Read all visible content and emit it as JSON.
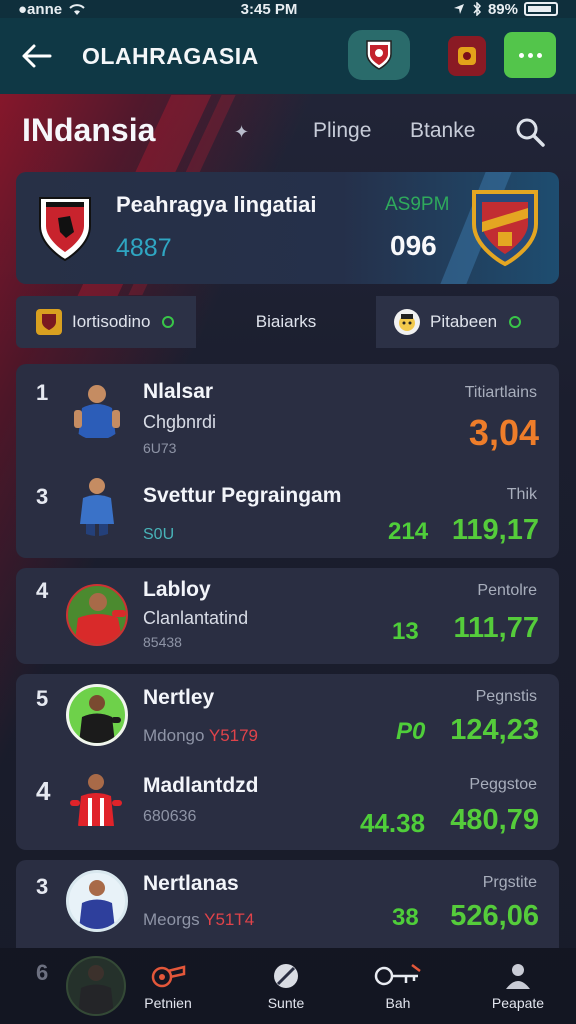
{
  "status_bar": {
    "carrier": "●anne",
    "time": "3:45 PM",
    "battery": "89%"
  },
  "app_bar": {
    "title": "OLAHRAGASIA"
  },
  "section": {
    "title": "INdansia",
    "tab_a": "Plinge",
    "tab_b": "Btanke"
  },
  "match": {
    "title": "Peahragya lingatiai",
    "score": "4887",
    "time": "AS9PM",
    "value": "096"
  },
  "filters": {
    "left": "Iortisodino",
    "middle": "Biaiarks",
    "right": "Pitabeen"
  },
  "cards": [
    {
      "rows": [
        {
          "rank": "1",
          "name": "Nlalsar",
          "team": "Chgbnrdi",
          "sub": "6U73",
          "label": "Titiartlains",
          "score": "3,04",
          "mid": ""
        },
        {
          "rank": "3",
          "name": "Svettur Pegraingam",
          "team": "",
          "sub": "S0U",
          "label": "Thik",
          "score": "119,17",
          "mid": "214"
        }
      ]
    },
    {
      "rows": [
        {
          "rank": "4",
          "name": "Labloy",
          "team": "Clanlantatind",
          "sub": "85438",
          "label": "Pentolre",
          "score": "111,77",
          "mid": "13"
        }
      ]
    },
    {
      "rows": [
        {
          "rank": "5",
          "name": "Nertley",
          "team": "",
          "sub": "Mdongo",
          "sub_red": "Y5179",
          "label": "Pegnstis",
          "score": "124,23",
          "mid": "P0"
        },
        {
          "rank": "4",
          "name": "Madlantdzd",
          "team": "",
          "sub": "680636",
          "label": "Peggstoe",
          "score": "480,79",
          "mid": "44.38"
        }
      ]
    },
    {
      "rows": [
        {
          "rank": "3",
          "name": "Nertlanas",
          "team": "",
          "sub": "Meorgs",
          "sub_red": "Y51T4",
          "label": "Prgstite",
          "score": "526,06",
          "mid": "38"
        }
      ]
    }
  ],
  "ghost_rank": "6",
  "bottom_nav": [
    {
      "label": "Petnien",
      "icon": "whistle-icon"
    },
    {
      "label": "Sunte",
      "icon": "ball-icon"
    },
    {
      "label": "Bah",
      "icon": "key-icon"
    },
    {
      "label": "Peapate",
      "icon": "profile-icon"
    }
  ],
  "colors": {
    "accent_green": "#55cc3b",
    "accent_orange": "#ee7d2a",
    "appbar": "#0f3845",
    "card": "#2a2e42"
  }
}
